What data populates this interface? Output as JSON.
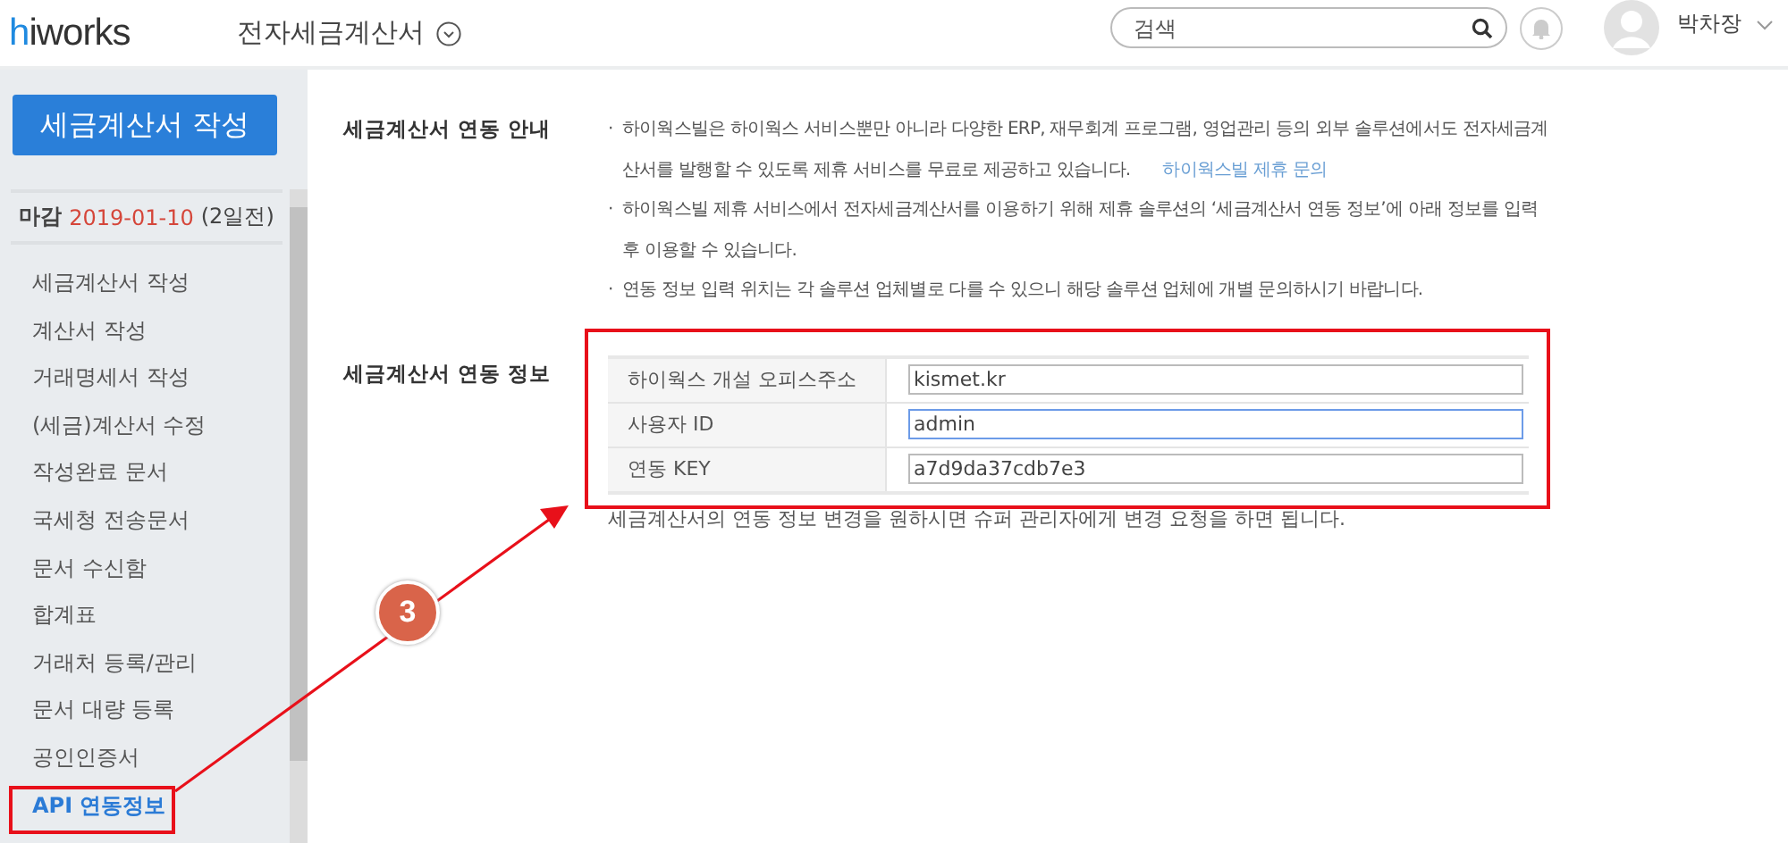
{
  "header": {
    "logo_accent": "h",
    "logo_rest": "iworks",
    "app_title": "전자세금계산서",
    "search": {
      "placeholder": "검색"
    },
    "user": "박차장"
  },
  "sidebar": {
    "write_button": "세금계산서 작성",
    "deadline": {
      "label": "마감",
      "date": "2019-01-10",
      "remaining": "(2일전)"
    },
    "items": [
      {
        "label": "세금계산서 작성",
        "selected": false
      },
      {
        "label": "계산서 작성",
        "selected": false
      },
      {
        "label": "거래명세서 작성",
        "selected": false
      },
      {
        "label": "(세금)계산서 수정",
        "selected": false
      },
      {
        "label": "작성완료 문서",
        "selected": false
      },
      {
        "label": "국세청 전송문서",
        "selected": false
      },
      {
        "label": "문서 수신함",
        "selected": false
      },
      {
        "label": "합계표",
        "selected": false
      },
      {
        "label": "거래처 등록/관리",
        "selected": false
      },
      {
        "label": "문서 대량 등록",
        "selected": false
      },
      {
        "label": "공인인증서",
        "selected": false
      },
      {
        "label": "API 연동정보",
        "selected": true
      }
    ]
  },
  "guide": {
    "title": "세금계산서 연동 안내",
    "marker": "·",
    "bullets": [
      {
        "text": "하이웍스빌은 하이웍스 서비스뿐만 아니라 다양한 ERP, 재무회계 프로그램, 영업관리 등의 외부 솔루션에서도 전자세금계산서를 발행할 수 있도록 제휴 서비스를 무료로 제공하고 있습니다.",
        "link": "하이웍스빌 제휴 문의"
      },
      {
        "text": "하이웍스빌 제휴 서비스에서 전자세금계산서를 이용하기 위해 제휴 솔루션의 ‘세금계산서 연동 정보’에 아래 정보를 입력 후 이용할 수 있습니다."
      },
      {
        "text": "연동 정보 입력 위치는 각 솔루션 업체별로 다를 수 있으니 해당 솔루션 업체에 개별 문의하시기 바랍니다."
      }
    ]
  },
  "info": {
    "title": "세금계산서 연동 정보",
    "rows": [
      {
        "label": "하이웍스 개설 오피스주소",
        "value": "kismet.kr",
        "focused": false
      },
      {
        "label": "사용자 ID",
        "value": "admin",
        "focused": true
      },
      {
        "label": "연동 KEY",
        "value": "a7d9da37cdb7e3",
        "focused": false
      }
    ],
    "note": "세금계산서의 연동 정보 변경을 원하시면 슈퍼 관리자에게 변경 요청을 하면 됩니다."
  },
  "annotation": {
    "step": "3"
  }
}
